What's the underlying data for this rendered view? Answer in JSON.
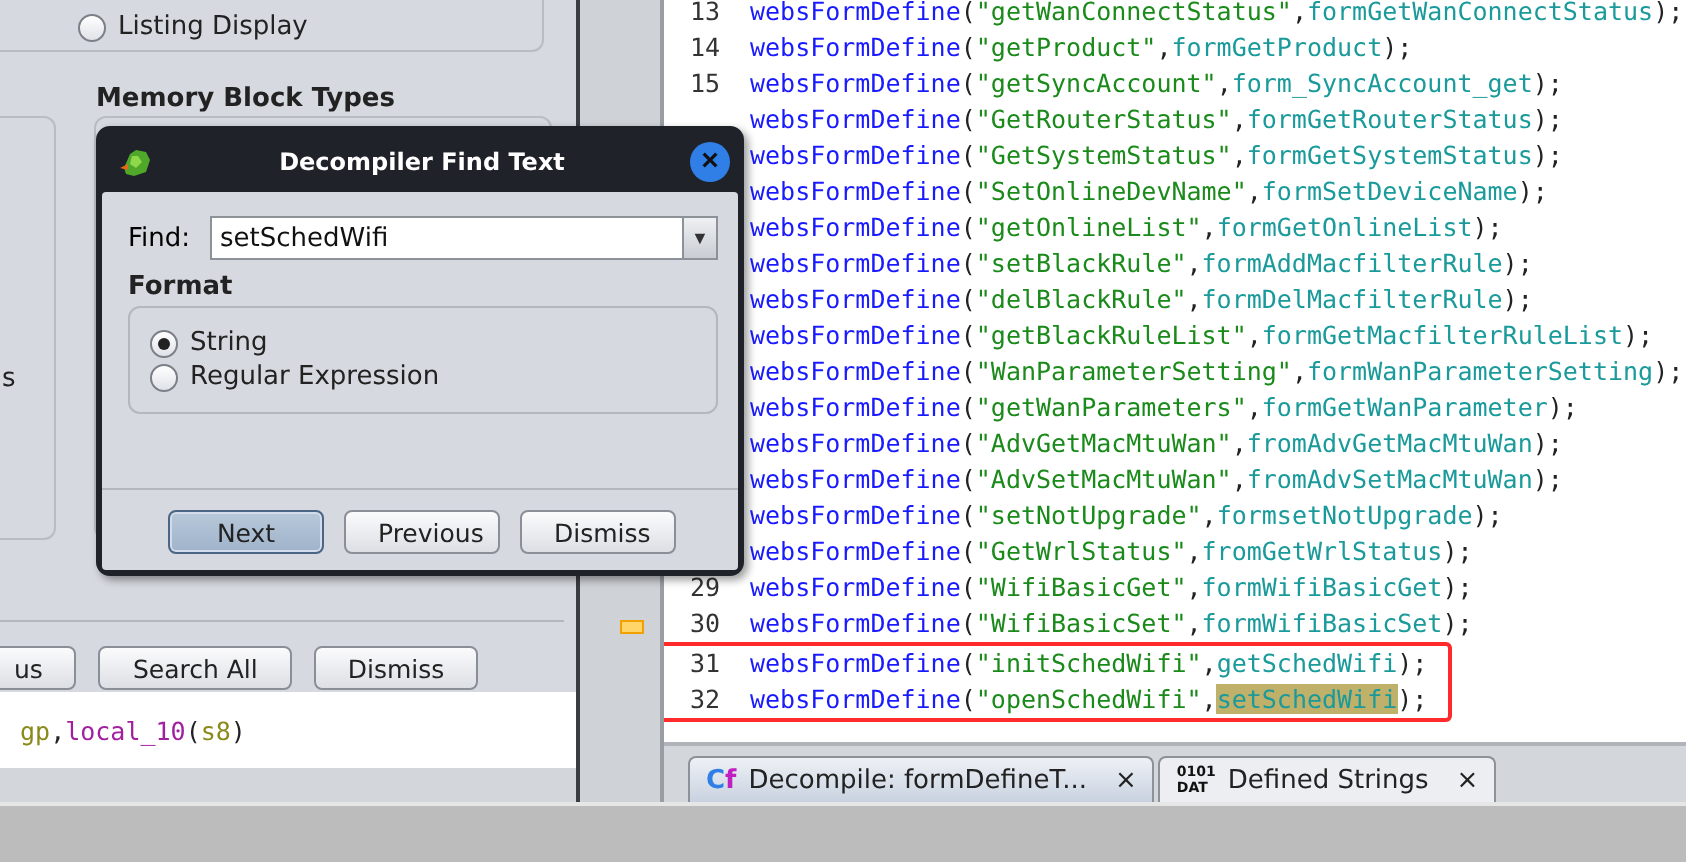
{
  "options_panel": {
    "radios": [
      {
        "label": "Listing Display",
        "selected": false
      }
    ],
    "section_title": "Memory Block Types",
    "cut_label": "s",
    "buttons": [
      "us",
      "Search All",
      "Dismiss"
    ]
  },
  "left_code": [
    {
      "kind": "var",
      "text": "gp"
    },
    {
      "kind": "punct",
      "text": ","
    },
    {
      "kind": "local",
      "text": "local_10"
    },
    {
      "kind": "punct",
      "text": "("
    },
    {
      "kind": "var",
      "text": "s8"
    },
    {
      "kind": "punct",
      "text": ")"
    }
  ],
  "editor": {
    "lines": [
      {
        "number": "13",
        "parts": [
          "websFormDefine",
          "(",
          "\"getWanConnectStatus\"",
          ",",
          "formGetWanConnectStatus",
          ");"
        ]
      },
      {
        "number": "14",
        "parts": [
          "websFormDefine",
          "(",
          "\"getProduct\"",
          ",",
          "formGetProduct",
          ");"
        ]
      },
      {
        "number": "15",
        "parts": [
          "websFormDefine",
          "(",
          "\"getSyncAccount\"",
          ",",
          "form_SyncAccount_get",
          ");"
        ]
      },
      {
        "parts": [
          "websFormDefine",
          "(",
          "\"GetRouterStatus\"",
          ",",
          "formGetRouterStatus",
          ");"
        ]
      },
      {
        "parts": [
          "websFormDefine",
          "(",
          "\"GetSystemStatus\"",
          ",",
          "formGetSystemStatus",
          ");"
        ]
      },
      {
        "parts": [
          "websFormDefine",
          "(",
          "\"SetOnlineDevName\"",
          ",",
          "formSetDeviceName",
          ");"
        ]
      },
      {
        "parts": [
          "websFormDefine",
          "(",
          "\"getOnlineList\"",
          ",",
          "formGetOnlineList",
          ");"
        ]
      },
      {
        "parts": [
          "websFormDefine",
          "(",
          "\"setBlackRule\"",
          ",",
          "formAddMacfilterRule",
          ");"
        ]
      },
      {
        "parts": [
          "websFormDefine",
          "(",
          "\"delBlackRule\"",
          ",",
          "formDelMacfilterRule",
          ");"
        ]
      },
      {
        "parts": [
          "websFormDefine",
          "(",
          "\"getBlackRuleList\"",
          ",",
          "formGetMacfilterRuleList",
          ");"
        ]
      },
      {
        "parts": [
          "websFormDefine",
          "(",
          "\"WanParameterSetting\"",
          ",",
          "formWanParameterSetting",
          ");"
        ]
      },
      {
        "parts": [
          "websFormDefine",
          "(",
          "\"getWanParameters\"",
          ",",
          "formGetWanParameter",
          ");"
        ]
      },
      {
        "parts": [
          "websFormDefine",
          "(",
          "\"AdvGetMacMtuWan\"",
          ",",
          "fromAdvGetMacMtuWan",
          ");"
        ]
      },
      {
        "parts": [
          "websFormDefine",
          "(",
          "\"AdvSetMacMtuWan\"",
          ",",
          "fromAdvSetMacMtuWan",
          ");"
        ]
      },
      {
        "parts": [
          "websFormDefine",
          "(",
          "\"setNotUpgrade\"",
          ",",
          "formsetNotUpgrade",
          ");"
        ]
      },
      {
        "parts": [
          "websFormDefine",
          "(",
          "\"GetWrlStatus\"",
          ",",
          "fromGetWrlStatus",
          ");"
        ]
      },
      {
        "number": "29",
        "parts": [
          "websFormDefine",
          "(",
          "\"WifiBasicGet\"",
          ",",
          "formWifiBasicGet",
          ");"
        ]
      },
      {
        "number": "30",
        "parts": [
          "websFormDefine",
          "(",
          "\"WifiBasicSet\"",
          ",",
          "formWifiBasicSet",
          ");"
        ]
      },
      {
        "number": "31",
        "boxed": true,
        "parts": [
          "websFormDefine",
          "(",
          "\"initSchedWifi\"",
          ",",
          "getSchedWifi",
          ");"
        ]
      },
      {
        "number": "32",
        "boxed": true,
        "match": true,
        "parts": [
          "websFormDefine",
          "(",
          "\"openSchedWifi\"",
          ",",
          "setSchedWifi",
          ");"
        ]
      }
    ]
  },
  "tabs": [
    {
      "label": "Decompile: formDefineT...",
      "selected": true,
      "kind": "decompile",
      "icon_text": [
        "C",
        "f"
      ],
      "close": "×"
    },
    {
      "label": "Defined Strings",
      "selected": false,
      "kind": "data",
      "icon_text": [
        "0101",
        "DAT"
      ],
      "close": "×"
    }
  ],
  "dialog": {
    "title": "Decompiler Find Text",
    "close": "×",
    "find_label": "Find:",
    "find_value": "setSchedWifi",
    "combo_arrow": "▼",
    "group_title": "Format",
    "radios": [
      {
        "label": "String",
        "selected": true
      },
      {
        "label": "Regular Expression",
        "selected": false
      }
    ],
    "buttons": [
      {
        "label": "Next",
        "default": true
      },
      {
        "label": "Previous",
        "default": false
      },
      {
        "label": "Dismiss",
        "default": false
      }
    ]
  }
}
